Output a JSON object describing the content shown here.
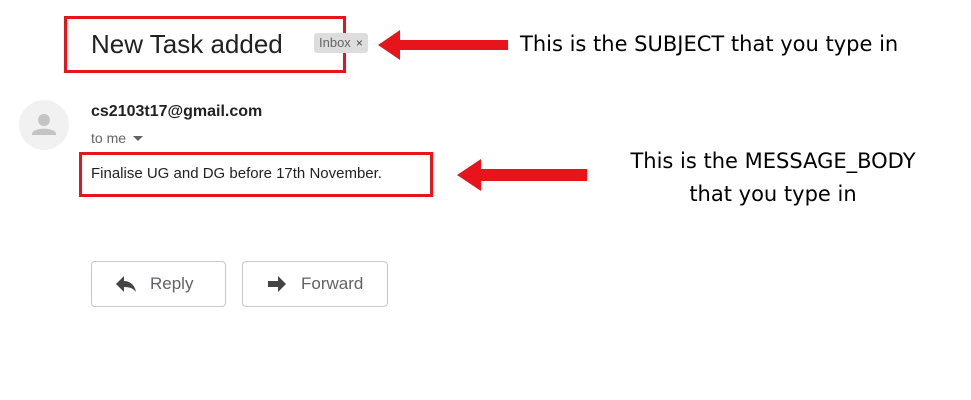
{
  "email": {
    "subject": "New Task added",
    "label": {
      "text": "Inbox",
      "remove_glyph": "×"
    },
    "sender": "cs2103t17@gmail.com",
    "recipient_line": "to me",
    "body": "Finalise UG and DG before 17th November."
  },
  "actions": {
    "reply_label": "Reply",
    "forward_label": "Forward"
  },
  "annotations": {
    "subject_note": "This is the SUBJECT that you type in",
    "body_note_line1": "This is the MESSAGE_BODY",
    "body_note_line2": "that you type in"
  },
  "colors": {
    "highlight": "#e8141c",
    "label_bg": "#dddddd"
  },
  "icons": {
    "reply": "reply-arrow-icon",
    "forward": "forward-arrow-icon",
    "avatar": "person-icon",
    "caret": "chevron-down-icon"
  }
}
